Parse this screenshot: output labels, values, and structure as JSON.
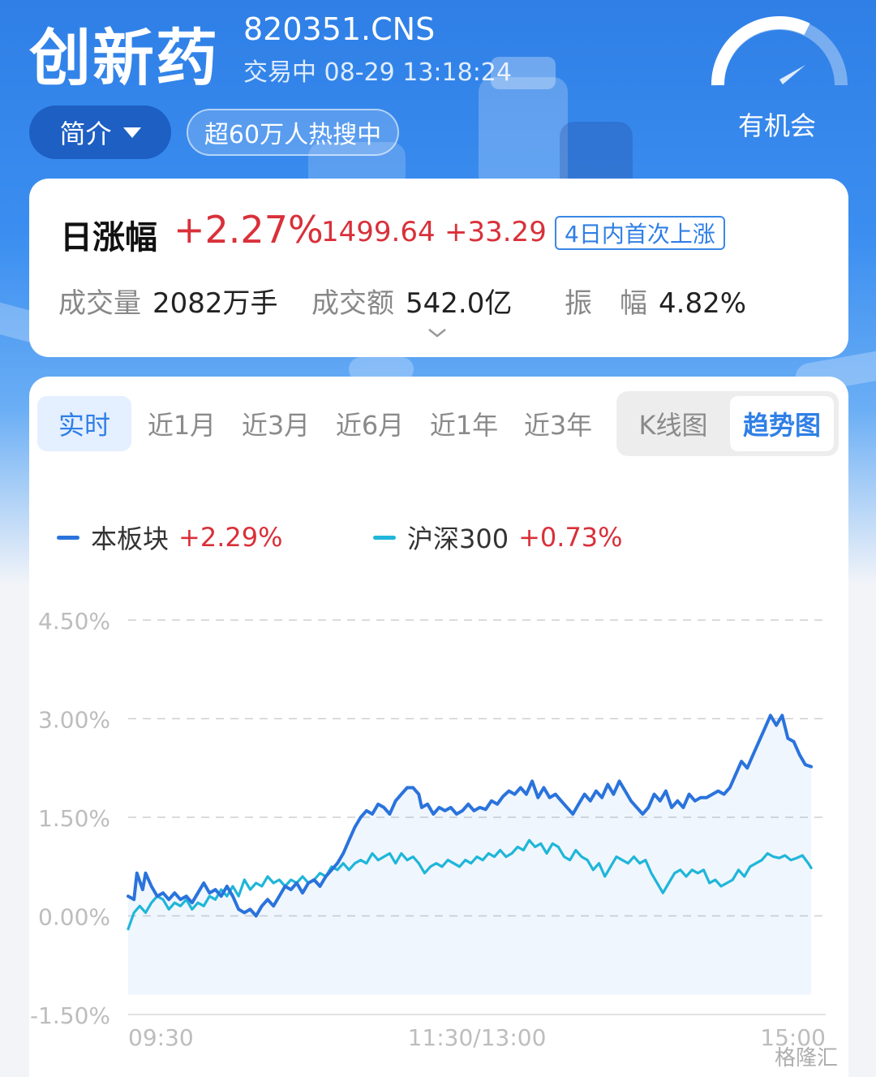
{
  "header": {
    "title": "创新药",
    "code": "820351.CNS",
    "status": "交易中 08-29 13:18:24",
    "gauge_label": "有机会",
    "intro_button": "简介",
    "hot_text": "超60万人热搜中"
  },
  "summary": {
    "change_label": "日涨幅",
    "change_pct": "+2.27%",
    "price": "1499.64",
    "change_abs": "+33.29",
    "badge": "4日内首次上涨",
    "volume_label": "成交量",
    "volume_value": "2082万手",
    "amount_label": "成交额",
    "amount_value": "542.0亿",
    "amplitude_label": "振　幅",
    "amplitude_value": "4.82%"
  },
  "tabs": [
    "实时",
    "近1月",
    "近3月",
    "近6月",
    "近1年",
    "近3年"
  ],
  "chart_toggle": [
    "K线图",
    "趋势图"
  ],
  "legend": [
    {
      "name": "本板块",
      "value": "+2.29%",
      "color": "#2a73dc"
    },
    {
      "name": "沪深300",
      "value": "+0.73%",
      "color": "#1fb6d9"
    }
  ],
  "watermark": "格隆汇",
  "colors": {
    "up": "#d9303a",
    "accent": "#2f7fe6"
  },
  "chart_data": {
    "type": "line",
    "y_tick_labels": [
      "4.50%",
      "3.00%",
      "1.50%",
      "0.00%",
      "-1.50%"
    ],
    "y_ticks": [
      4.5,
      3.0,
      1.5,
      0.0,
      -1.5
    ],
    "ylim": [
      -1.5,
      4.5
    ],
    "x_tick_labels": [
      "09:30",
      "11:30/13:00",
      "15:00"
    ],
    "x_ticks": [
      0,
      120,
      240
    ],
    "xlim": [
      0,
      240
    ],
    "grid": true,
    "series": [
      {
        "name": "本板块",
        "points": [
          [
            0,
            0.3
          ],
          [
            2,
            0.25
          ],
          [
            3,
            0.65
          ],
          [
            5,
            0.4
          ],
          [
            6,
            0.65
          ],
          [
            8,
            0.45
          ],
          [
            10,
            0.3
          ],
          [
            12,
            0.35
          ],
          [
            14,
            0.25
          ],
          [
            16,
            0.35
          ],
          [
            18,
            0.25
          ],
          [
            20,
            0.3
          ],
          [
            22,
            0.2
          ],
          [
            24,
            0.35
          ],
          [
            26,
            0.5
          ],
          [
            28,
            0.35
          ],
          [
            30,
            0.4
          ],
          [
            32,
            0.3
          ],
          [
            34,
            0.45
          ],
          [
            36,
            0.3
          ],
          [
            38,
            0.1
          ],
          [
            40,
            0.05
          ],
          [
            42,
            0.1
          ],
          [
            44,
            0.0
          ],
          [
            46,
            0.15
          ],
          [
            48,
            0.25
          ],
          [
            50,
            0.15
          ],
          [
            52,
            0.3
          ],
          [
            54,
            0.45
          ],
          [
            56,
            0.4
          ],
          [
            58,
            0.5
          ],
          [
            60,
            0.35
          ],
          [
            62,
            0.5
          ],
          [
            64,
            0.55
          ],
          [
            66,
            0.45
          ],
          [
            68,
            0.6
          ],
          [
            70,
            0.7
          ],
          [
            72,
            0.8
          ],
          [
            74,
            0.95
          ],
          [
            76,
            1.15
          ],
          [
            78,
            1.35
          ],
          [
            80,
            1.5
          ],
          [
            82,
            1.6
          ],
          [
            84,
            1.55
          ],
          [
            86,
            1.7
          ],
          [
            88,
            1.65
          ],
          [
            90,
            1.55
          ],
          [
            92,
            1.75
          ],
          [
            94,
            1.85
          ],
          [
            96,
            1.95
          ],
          [
            98,
            1.95
          ],
          [
            100,
            1.85
          ],
          [
            101,
            1.65
          ],
          [
            103,
            1.7
          ],
          [
            105,
            1.55
          ],
          [
            107,
            1.65
          ],
          [
            109,
            1.6
          ],
          [
            111,
            1.65
          ],
          [
            113,
            1.55
          ],
          [
            115,
            1.6
          ],
          [
            117,
            1.7
          ],
          [
            119,
            1.6
          ],
          [
            121,
            1.65
          ],
          [
            123,
            1.62
          ],
          [
            125,
            1.75
          ],
          [
            127,
            1.7
          ],
          [
            129,
            1.82
          ],
          [
            131,
            1.9
          ],
          [
            133,
            1.85
          ],
          [
            135,
            1.95
          ],
          [
            137,
            1.85
          ],
          [
            139,
            2.05
          ],
          [
            141,
            1.8
          ],
          [
            143,
            1.95
          ],
          [
            145,
            1.8
          ],
          [
            147,
            1.85
          ],
          [
            149,
            1.75
          ],
          [
            151,
            1.65
          ],
          [
            153,
            1.55
          ],
          [
            155,
            1.7
          ],
          [
            157,
            1.85
          ],
          [
            159,
            1.75
          ],
          [
            161,
            1.9
          ],
          [
            163,
            1.8
          ],
          [
            165,
            2.0
          ],
          [
            167,
            1.85
          ],
          [
            169,
            2.05
          ],
          [
            171,
            1.9
          ],
          [
            173,
            1.75
          ],
          [
            175,
            1.65
          ],
          [
            177,
            1.55
          ],
          [
            179,
            1.65
          ],
          [
            181,
            1.85
          ],
          [
            183,
            1.75
          ],
          [
            185,
            1.9
          ],
          [
            187,
            1.65
          ],
          [
            189,
            1.75
          ],
          [
            191,
            1.65
          ],
          [
            193,
            1.85
          ],
          [
            195,
            1.75
          ],
          [
            197,
            1.8
          ],
          [
            199,
            1.8
          ],
          [
            201,
            1.85
          ],
          [
            203,
            1.9
          ],
          [
            205,
            1.85
          ],
          [
            207,
            1.95
          ],
          [
            209,
            2.15
          ],
          [
            211,
            2.35
          ],
          [
            213,
            2.25
          ],
          [
            215,
            2.45
          ],
          [
            217,
            2.65
          ],
          [
            219,
            2.85
          ],
          [
            221,
            3.05
          ],
          [
            223,
            2.9
          ],
          [
            225,
            3.05
          ],
          [
            227,
            2.7
          ],
          [
            229,
            2.65
          ],
          [
            231,
            2.45
          ],
          [
            233,
            2.3
          ],
          [
            235,
            2.27
          ]
        ]
      },
      {
        "name": "沪深300",
        "points": [
          [
            0,
            -0.2
          ],
          [
            2,
            0.05
          ],
          [
            4,
            0.15
          ],
          [
            6,
            0.05
          ],
          [
            8,
            0.2
          ],
          [
            10,
            0.3
          ],
          [
            12,
            0.25
          ],
          [
            14,
            0.1
          ],
          [
            16,
            0.2
          ],
          [
            18,
            0.15
          ],
          [
            20,
            0.25
          ],
          [
            22,
            0.1
          ],
          [
            24,
            0.2
          ],
          [
            26,
            0.15
          ],
          [
            28,
            0.3
          ],
          [
            30,
            0.25
          ],
          [
            32,
            0.4
          ],
          [
            34,
            0.3
          ],
          [
            36,
            0.45
          ],
          [
            38,
            0.3
          ],
          [
            40,
            0.55
          ],
          [
            42,
            0.4
          ],
          [
            44,
            0.5
          ],
          [
            46,
            0.45
          ],
          [
            48,
            0.6
          ],
          [
            50,
            0.5
          ],
          [
            52,
            0.55
          ],
          [
            54,
            0.45
          ],
          [
            56,
            0.55
          ],
          [
            58,
            0.5
          ],
          [
            60,
            0.6
          ],
          [
            62,
            0.5
          ],
          [
            64,
            0.55
          ],
          [
            66,
            0.65
          ],
          [
            68,
            0.6
          ],
          [
            70,
            0.75
          ],
          [
            72,
            0.7
          ],
          [
            74,
            0.8
          ],
          [
            76,
            0.7
          ],
          [
            78,
            0.8
          ],
          [
            80,
            0.85
          ],
          [
            82,
            0.8
          ],
          [
            84,
            0.95
          ],
          [
            86,
            0.85
          ],
          [
            88,
            0.9
          ],
          [
            90,
            0.95
          ],
          [
            92,
            0.8
          ],
          [
            94,
            0.95
          ],
          [
            96,
            0.85
          ],
          [
            98,
            0.9
          ],
          [
            100,
            0.8
          ],
          [
            102,
            0.65
          ],
          [
            104,
            0.75
          ],
          [
            106,
            0.8
          ],
          [
            108,
            0.75
          ],
          [
            110,
            0.85
          ],
          [
            112,
            0.8
          ],
          [
            114,
            0.75
          ],
          [
            116,
            0.85
          ],
          [
            118,
            0.8
          ],
          [
            120,
            0.9
          ],
          [
            122,
            0.85
          ],
          [
            124,
            0.95
          ],
          [
            126,
            0.9
          ],
          [
            128,
            1.0
          ],
          [
            130,
            0.9
          ],
          [
            132,
            0.95
          ],
          [
            134,
            1.05
          ],
          [
            136,
            1.0
          ],
          [
            138,
            1.15
          ],
          [
            140,
            1.05
          ],
          [
            142,
            1.1
          ],
          [
            144,
            0.95
          ],
          [
            146,
            1.1
          ],
          [
            148,
            1.05
          ],
          [
            150,
            0.9
          ],
          [
            152,
            0.85
          ],
          [
            154,
            1.0
          ],
          [
            156,
            0.9
          ],
          [
            158,
            0.85
          ],
          [
            160,
            0.7
          ],
          [
            162,
            0.8
          ],
          [
            164,
            0.6
          ],
          [
            166,
            0.75
          ],
          [
            168,
            0.9
          ],
          [
            170,
            0.85
          ],
          [
            172,
            0.8
          ],
          [
            174,
            0.9
          ],
          [
            176,
            0.8
          ],
          [
            178,
            0.85
          ],
          [
            180,
            0.65
          ],
          [
            182,
            0.5
          ],
          [
            184,
            0.35
          ],
          [
            186,
            0.5
          ],
          [
            188,
            0.65
          ],
          [
            190,
            0.7
          ],
          [
            192,
            0.6
          ],
          [
            194,
            0.7
          ],
          [
            196,
            0.65
          ],
          [
            198,
            0.7
          ],
          [
            200,
            0.5
          ],
          [
            202,
            0.55
          ],
          [
            204,
            0.45
          ],
          [
            206,
            0.5
          ],
          [
            208,
            0.55
          ],
          [
            210,
            0.7
          ],
          [
            212,
            0.6
          ],
          [
            214,
            0.75
          ],
          [
            216,
            0.8
          ],
          [
            218,
            0.85
          ],
          [
            220,
            0.95
          ],
          [
            222,
            0.9
          ],
          [
            224,
            0.88
          ],
          [
            226,
            0.92
          ],
          [
            228,
            0.85
          ],
          [
            230,
            0.88
          ],
          [
            232,
            0.92
          ],
          [
            234,
            0.8
          ],
          [
            235,
            0.73
          ]
        ]
      }
    ]
  }
}
